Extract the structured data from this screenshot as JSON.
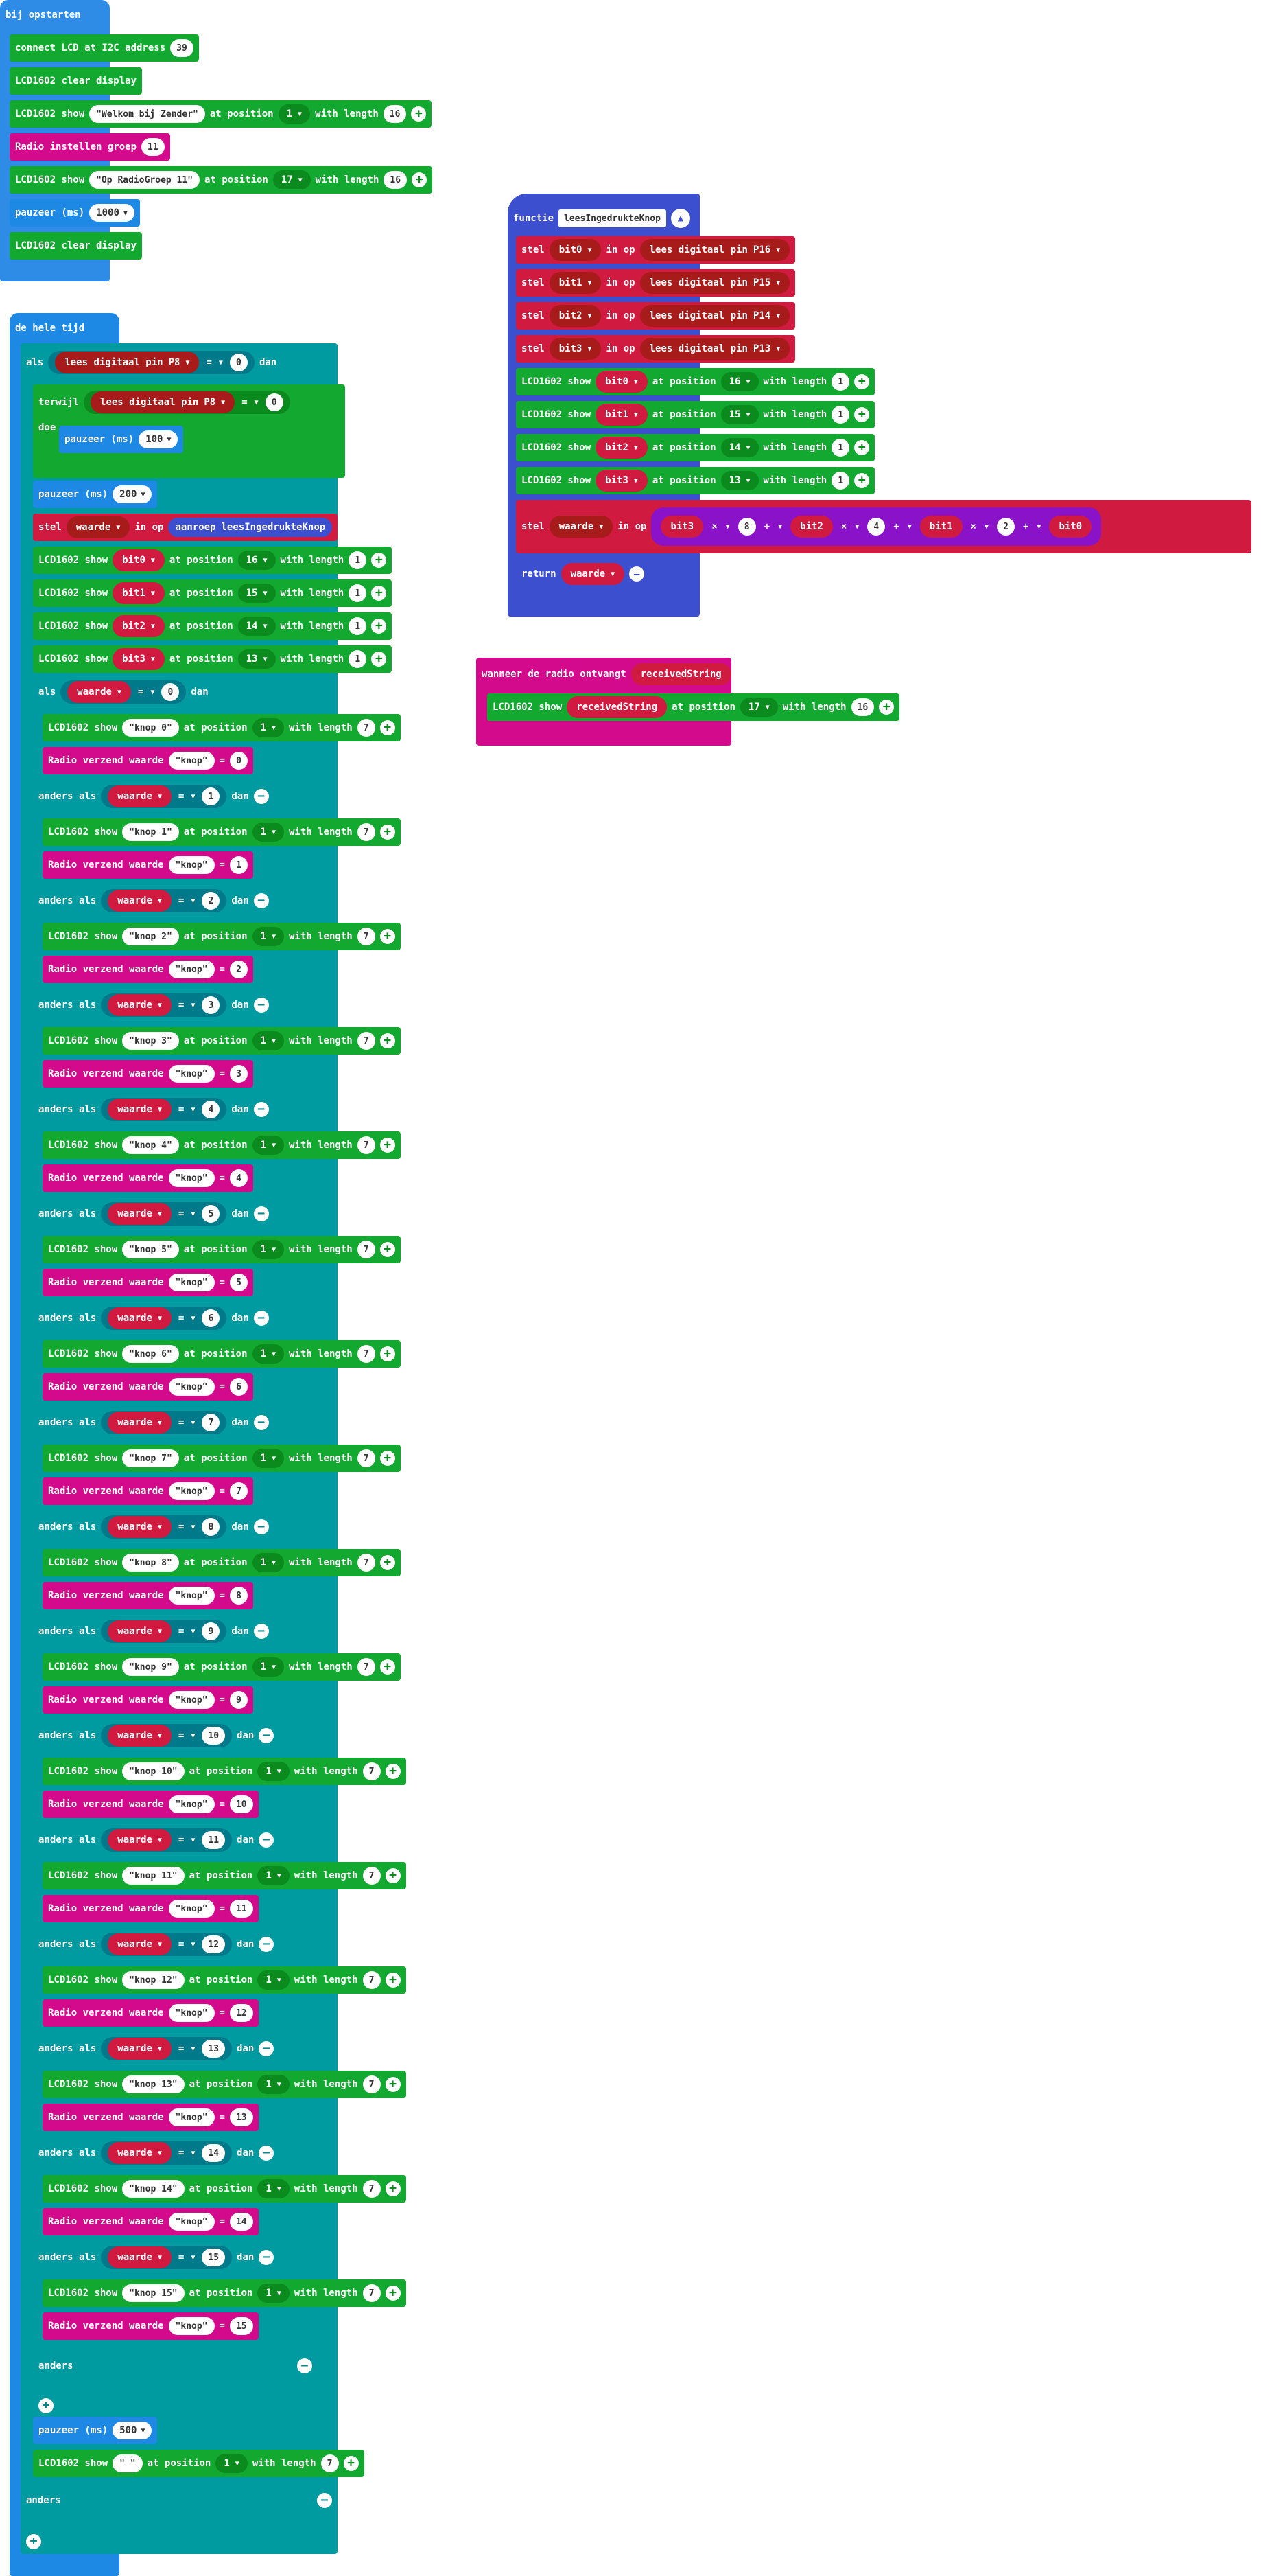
{
  "colors": {
    "lcd": "#13a82f",
    "radio": "#d30a8c",
    "basic": "#2e8ce6",
    "logic": "#009aa1",
    "variable": "#d11a40",
    "function": "#3b4fcf",
    "math": "#8a12c9"
  },
  "on_start": {
    "header": "bij opstarten",
    "connect": {
      "label": "connect LCD at I2C address",
      "value": "39"
    },
    "clear": "LCD1602 clear display",
    "show1": {
      "l1": "LCD1602 show",
      "str": "\"Welkom bij Zender\"",
      "l2": "at position",
      "pos": "1",
      "l3": "with length",
      "len": "16"
    },
    "radio_group": {
      "label": "Radio instellen groep",
      "value": "11"
    },
    "show2": {
      "l1": "LCD1602 show",
      "str": "\"Op RadioGroep 11\"",
      "l2": "at position",
      "pos": "17",
      "l3": "with length",
      "len": "16"
    },
    "pause": {
      "label": "pauzeer (ms)",
      "value": "1000"
    },
    "clear2": "LCD1602 clear display"
  },
  "forever": {
    "header": "de hele tijd",
    "if_label": "als",
    "dan": "dan",
    "read_pin": "lees digitaal pin",
    "pin": "P8",
    "eq": "=",
    "zero": "0",
    "while_label": "terwijl",
    "doe": "doe",
    "pause100": {
      "label": "pauzeer (ms)",
      "value": "100"
    },
    "pause200": {
      "label": "pauzeer (ms)",
      "value": "200"
    },
    "set_label": "stel",
    "waarde": "waarde",
    "in_op": "in op",
    "call_label": "aanroep",
    "call_name": "leesIngedrukteKnop",
    "lcd_show": "LCD1602 show",
    "at_pos": "at position",
    "with_len": "with length",
    "bits": [
      {
        "var": "bit0",
        "pos": "16",
        "len": "1"
      },
      {
        "var": "bit1",
        "pos": "15",
        "len": "1"
      },
      {
        "var": "bit2",
        "pos": "14",
        "len": "1"
      },
      {
        "var": "bit3",
        "pos": "13",
        "len": "1"
      }
    ],
    "inner_if": "als",
    "else_if": "anders als",
    "radio_send": "Radio verzend waarde",
    "key_str": "\"knop\"",
    "cases": [
      {
        "v": "0",
        "str": "\"knop 0\"",
        "pos": "1",
        "len": "7"
      },
      {
        "v": "1",
        "str": "\"knop 1\"",
        "pos": "1",
        "len": "7"
      },
      {
        "v": "2",
        "str": "\"knop 2\"",
        "pos": "1",
        "len": "7"
      },
      {
        "v": "3",
        "str": "\"knop 3\"",
        "pos": "1",
        "len": "7"
      },
      {
        "v": "4",
        "str": "\"knop 4\"",
        "pos": "1",
        "len": "7"
      },
      {
        "v": "5",
        "str": "\"knop 5\"",
        "pos": "1",
        "len": "7"
      },
      {
        "v": "6",
        "str": "\"knop 6\"",
        "pos": "1",
        "len": "7"
      },
      {
        "v": "7",
        "str": "\"knop 7\"",
        "pos": "1",
        "len": "7"
      },
      {
        "v": "8",
        "str": "\"knop 8\"",
        "pos": "1",
        "len": "7"
      },
      {
        "v": "9",
        "str": "\"knop 9\"",
        "pos": "1",
        "len": "7"
      },
      {
        "v": "10",
        "str": "\"knop 10\"",
        "pos": "1",
        "len": "7"
      },
      {
        "v": "11",
        "str": "\"knop 11\"",
        "pos": "1",
        "len": "7"
      },
      {
        "v": "12",
        "str": "\"knop 12\"",
        "pos": "1",
        "len": "7"
      },
      {
        "v": "13",
        "str": "\"knop 13\"",
        "pos": "1",
        "len": "7"
      },
      {
        "v": "14",
        "str": "\"knop 14\"",
        "pos": "1",
        "len": "7"
      },
      {
        "v": "15",
        "str": "\"knop 15\"",
        "pos": "1",
        "len": "7"
      }
    ],
    "anders": "anders",
    "pause500": {
      "label": "pauzeer (ms)",
      "value": "500"
    },
    "show_empty": {
      "str": "\" \"",
      "pos": "1",
      "len": "7"
    }
  },
  "function": {
    "label": "functie",
    "name": "leesIngedrukteKnop",
    "reads": [
      {
        "var": "bit0",
        "pin": "P16"
      },
      {
        "var": "bit1",
        "pin": "P15"
      },
      {
        "var": "bit2",
        "pin": "P14"
      },
      {
        "var": "bit3",
        "pin": "P13"
      }
    ],
    "shows": [
      {
        "var": "bit0",
        "pos": "16",
        "len": "1"
      },
      {
        "var": "bit1",
        "pos": "15",
        "len": "1"
      },
      {
        "var": "bit2",
        "pos": "14",
        "len": "1"
      },
      {
        "var": "bit3",
        "pos": "13",
        "len": "1"
      }
    ],
    "formula": {
      "a": "bit3",
      "op1": "×",
      "n1": "8",
      "plus": "+",
      "b": "bit2",
      "n2": "4",
      "c": "bit1",
      "n3": "2",
      "d": "bit0"
    },
    "return": "return"
  },
  "radio_recv": {
    "header": "wanneer de radio ontvangt",
    "param": "receivedString",
    "show": {
      "l1": "LCD1602 show",
      "var": "receivedString",
      "l2": "at position",
      "pos": "17",
      "l3": "with length",
      "len": "16"
    }
  }
}
